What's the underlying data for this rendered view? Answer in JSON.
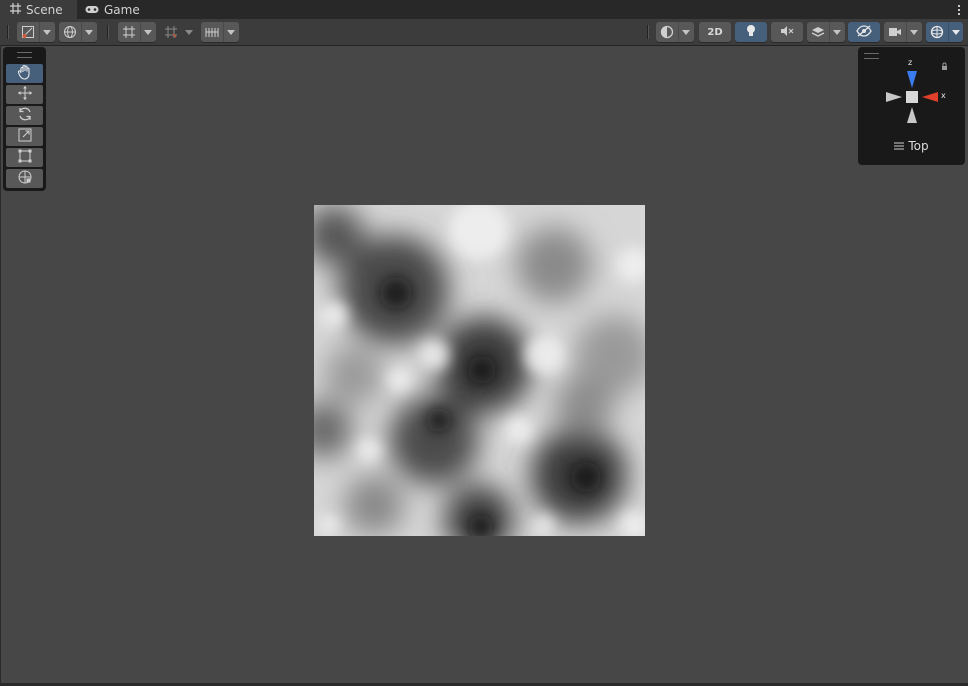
{
  "tabs": [
    {
      "label": "Scene",
      "icon": "grid-hash-icon",
      "active": true
    },
    {
      "label": "Game",
      "icon": "gamepad-icon",
      "active": false
    }
  ],
  "toolbar": {
    "toggle_2d_label": "2D",
    "left_tools": [
      "draw-mode",
      "global-local",
      "grid-snapping",
      "increment-snapping",
      "grid-visibility"
    ],
    "right_tools": [
      "shading-mode",
      "2d-toggle",
      "lighting-toggle",
      "audio-toggle",
      "effects-toggle",
      "visibility-toggle",
      "camera-settings",
      "gizmos"
    ]
  },
  "tools_overlay": {
    "tools": [
      {
        "name": "hand-tool",
        "icon": "hand-icon",
        "active": true
      },
      {
        "name": "move-tool",
        "icon": "move-arrows-icon",
        "active": false
      },
      {
        "name": "rotate-tool",
        "icon": "rotate-icon",
        "active": false
      },
      {
        "name": "scale-tool",
        "icon": "scale-icon",
        "active": false
      },
      {
        "name": "rect-tool",
        "icon": "rect-icon",
        "active": false
      },
      {
        "name": "transform-tool",
        "icon": "transform-icon",
        "active": false
      }
    ]
  },
  "gizmo": {
    "z_label": "z",
    "x_label": "x",
    "view_label": "Top",
    "colors": {
      "z": "#3b7cf0",
      "x": "#e0402a",
      "neutral": "#c8c8c8"
    }
  },
  "colors": {
    "scene_background": "#474747",
    "toolbar": "#3c3c3c",
    "tabbar": "#282828",
    "accent_active": "#46607c"
  }
}
